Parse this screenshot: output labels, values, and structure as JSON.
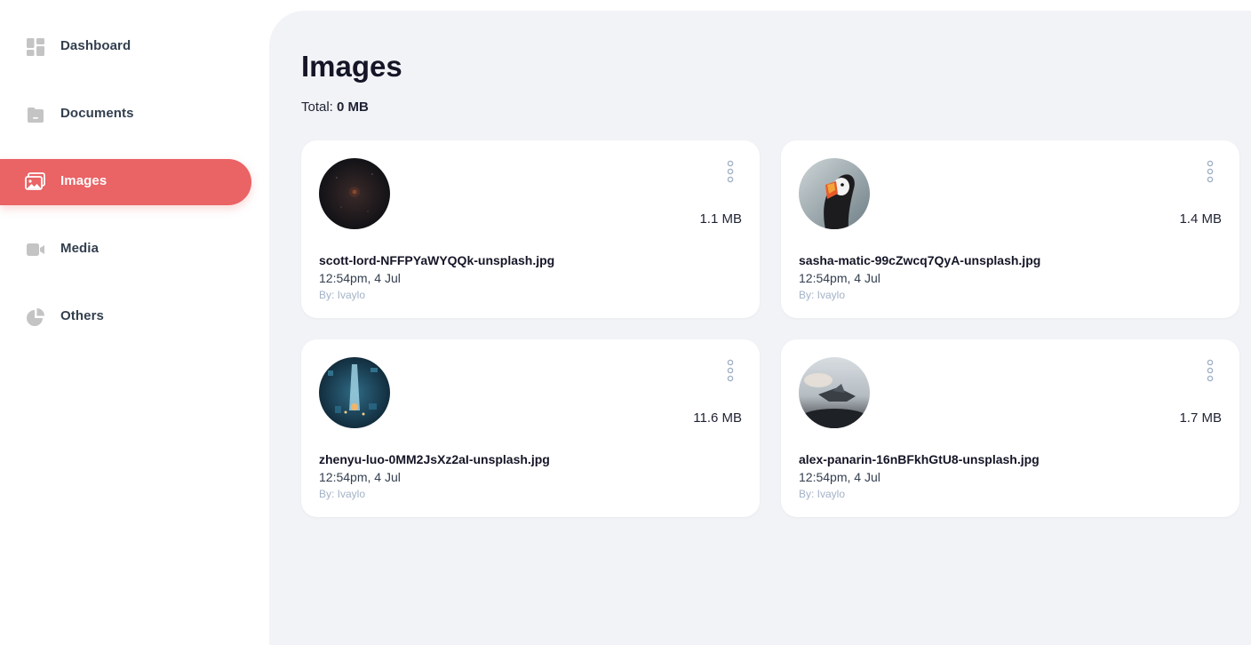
{
  "sidebar": {
    "items": [
      {
        "label": "Dashboard",
        "icon": "dashboard-icon",
        "active": false
      },
      {
        "label": "Documents",
        "icon": "documents-icon",
        "active": false
      },
      {
        "label": "Images",
        "icon": "images-icon",
        "active": true
      },
      {
        "label": "Media",
        "icon": "media-icon",
        "active": false
      },
      {
        "label": "Others",
        "icon": "pie-chart-icon",
        "active": false
      }
    ]
  },
  "main": {
    "title": "Images",
    "total_label": "Total:",
    "total_value": "0 MB"
  },
  "files": [
    {
      "name": "scott-lord-NFFPYaWYQQk-unsplash.jpg",
      "size": "1.1 MB",
      "date": "12:54pm, 4 Jul",
      "by": "By: Ivaylo"
    },
    {
      "name": "sasha-matic-99cZwcq7QyA-unsplash.jpg",
      "size": "1.4 MB",
      "date": "12:54pm, 4 Jul",
      "by": "By: Ivaylo"
    },
    {
      "name": "zhenyu-luo-0MM2JsXz2aI-unsplash.jpg",
      "size": "11.6 MB",
      "date": "12:54pm, 4 Jul",
      "by": "By: Ivaylo"
    },
    {
      "name": "alex-panarin-16nBFkhGtU8-unsplash.jpg",
      "size": "1.7 MB",
      "date": "12:54pm, 4 Jul",
      "by": "By: Ivaylo"
    }
  ],
  "colors": {
    "accent": "#ea6365",
    "main_bg": "#f2f3f7",
    "icon_gray": "#c4c4c4",
    "muted_text": "#a3b2c7"
  }
}
